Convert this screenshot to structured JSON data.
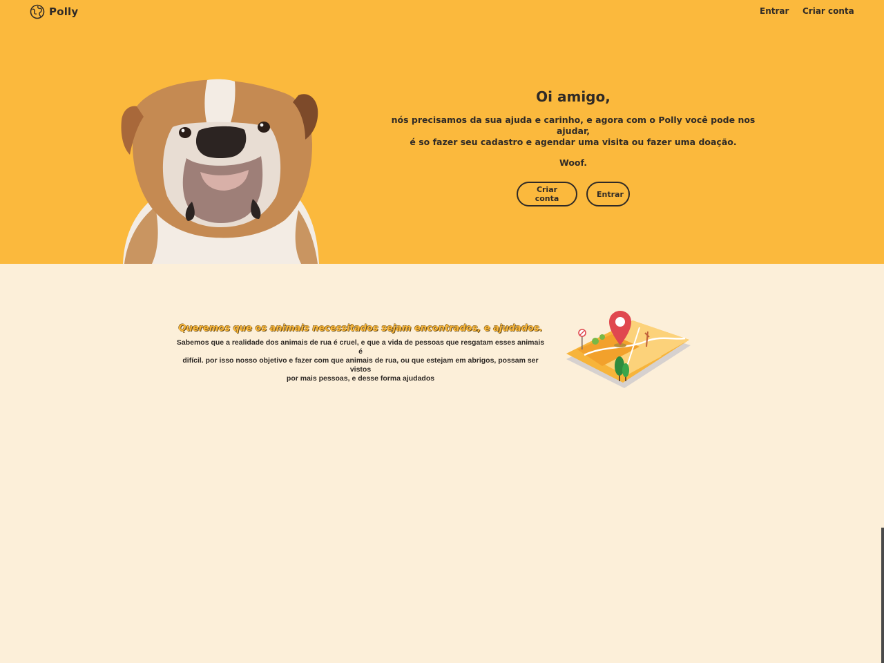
{
  "brand": {
    "name": "Polly"
  },
  "nav": {
    "login": "Entrar",
    "signup": "Criar conta"
  },
  "hero": {
    "greeting": "Oi amigo,",
    "line1": "nós precisamos da sua ajuda e carinho, e agora com o Polly você pode nos ajudar,",
    "line2": "é so fazer seu cadastro e agendar uma visita ou fazer uma doação.",
    "woof": "Woof.",
    "signup_button": "Criar conta",
    "login_button": "Entrar"
  },
  "mission": {
    "title": "Queremos que os animais necessitados sejam encontrados, e ajudados.",
    "line1": "Sabemos que a realidade dos animais de rua é cruel, e que a vida de pessoas que resgatam esses animais é",
    "line2": "difícil. por isso nosso objetivo e fazer com que animais de rua, ou que estejam em abrigos, possam ser vistos",
    "line3": "por mais pessoas, e desse forma ajudados"
  },
  "colors": {
    "hero_bg": "#fbb93d",
    "section_bg": "#fcefd9",
    "text": "#2f2a26",
    "pin": "#e0484f"
  }
}
